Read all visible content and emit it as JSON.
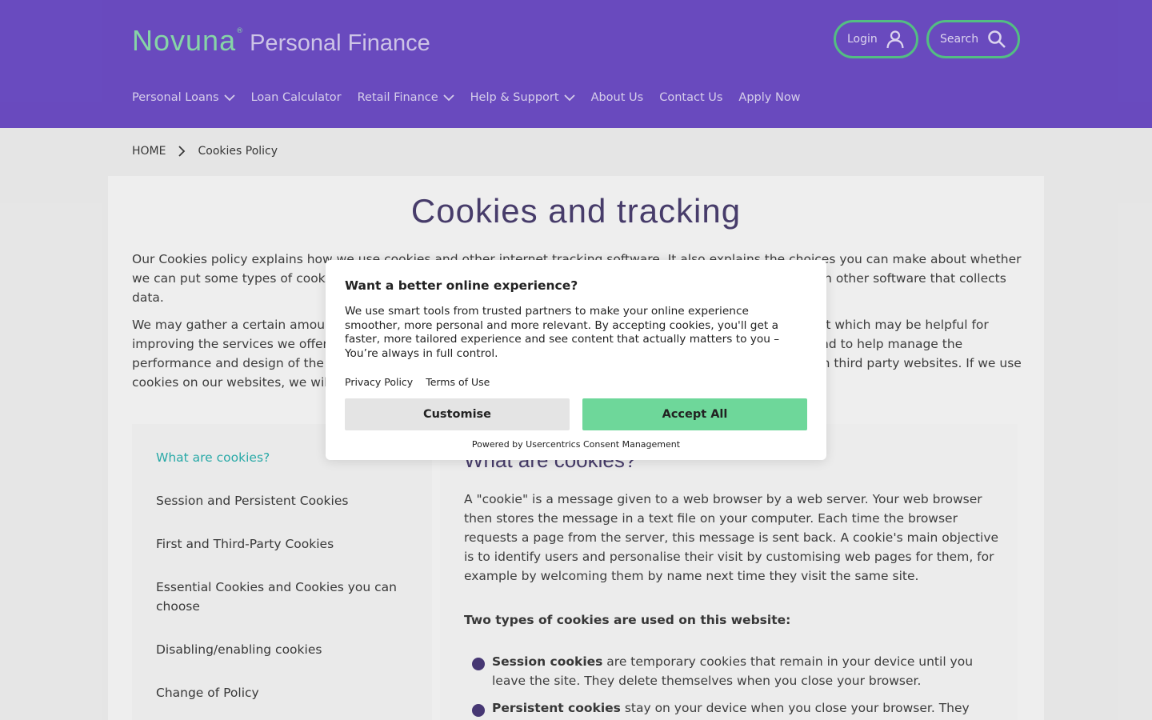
{
  "header": {
    "logo_brand": "Novuna",
    "logo_reg": "®",
    "logo_sub": "Personal Finance",
    "login_label": "Login",
    "search_label": "Search",
    "nav": [
      {
        "label": "Personal Loans",
        "has_dropdown": true
      },
      {
        "label": "Loan Calculator",
        "has_dropdown": false
      },
      {
        "label": "Retail Finance",
        "has_dropdown": true
      },
      {
        "label": "Help & Support",
        "has_dropdown": true
      },
      {
        "label": "About Us",
        "has_dropdown": false
      },
      {
        "label": "Contact Us",
        "has_dropdown": false
      },
      {
        "label": "Apply Now",
        "has_dropdown": false
      }
    ],
    "icons": {
      "login": "user-icon",
      "search": "search-icon",
      "dropdown": "chevron-down-icon"
    }
  },
  "breadcrumb": {
    "home": "HOME",
    "current": "Cookies Policy"
  },
  "page": {
    "title": "Cookies and tracking",
    "intro_1": "Our Cookies policy explains how we use cookies and other internet tracking software. It also explains the choices you can make about whether we can put some types of cookies on your computer or device. When we use the term 'cookies' it can also mean other software that collects data.",
    "intro_2": "We may gather a certain amount of information about you, including things that do not directly identify you, but which may be helpful for improving the services we offer. We use cookies for statistical reporting, to analyse website traffic and usage and to help manage the performance and design of the website. We may also use cookies to show you more relevant advertisements on third party websites. If we use cookies on our websites, we will ask for your consent first."
  },
  "toc": [
    {
      "label": "What are cookies?",
      "active": true
    },
    {
      "label": "Session and Persistent Cookies",
      "active": false
    },
    {
      "label": "First and Third-Party Cookies",
      "active": false
    },
    {
      "label": "Essential Cookies and Cookies you can choose",
      "active": false
    },
    {
      "label": "Disabling/enabling cookies",
      "active": false
    },
    {
      "label": "Change of Policy",
      "active": false
    }
  ],
  "section": {
    "heading": "What are cookies?",
    "body": "A \"cookie\" is a message given to a web browser by a web server. Your web browser then stores the message in a text file on your computer. Each time the browser requests a page from the server, this message is sent back. A cookie's main objective is to identify users and personalise their visit by customising web pages for them, for example by welcoming them by name next time they visit the same site.",
    "subheading": "Two types of cookies are used on this website:",
    "bullets": [
      {
        "term": "Session cookies",
        "text": " are temporary cookies that remain in your device until you leave the site. They delete themselves when you close your browser."
      },
      {
        "term": "Persistent cookies",
        "text": " stay on your device when you close your browser. They"
      }
    ]
  },
  "consent": {
    "title": "Want a better online experience?",
    "text": "We use smart tools from trusted partners to make your online experience smoother, more personal and more relevant. By accepting cookies, you'll get a faster, more tailored experience and see content that actually matters to you – You’re always in full control.",
    "privacy_link": "Privacy Policy",
    "terms_link": "Terms of Use",
    "customise_label": "Customise",
    "accept_label": "Accept All",
    "powered_by": "Powered by Usercentrics Consent Management"
  },
  "colors": {
    "header_bg": "#6f4fc9",
    "brand_green": "#58c98a",
    "accept_green": "#6ed79a",
    "toc_active": "#2bb3b0",
    "title_purple": "#4b4070"
  }
}
